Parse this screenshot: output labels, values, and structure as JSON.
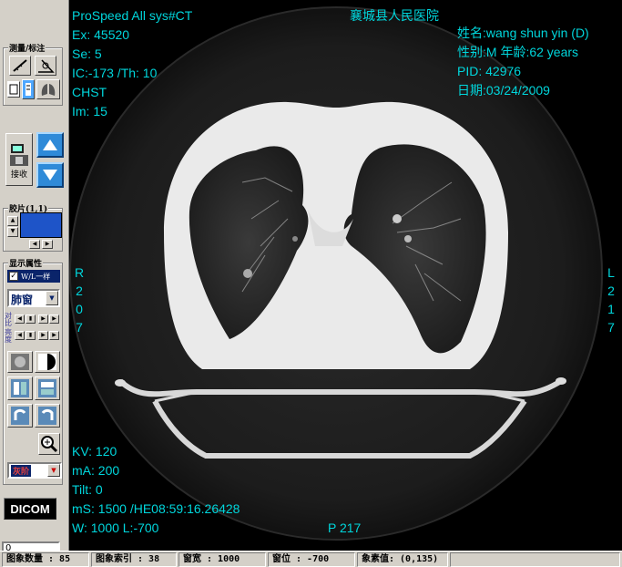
{
  "left_panel": {
    "measure_group_title": "测量/标注",
    "transfer_label": "接收",
    "film_group_title": "胶片(1,1)",
    "display_group_title": "显示属性",
    "same_checkbox_label": "W/L一样",
    "window_preset": "肺窗",
    "contrast_label": "对比",
    "brightness_label": "亮度",
    "color_select": "灰阶",
    "dicom_label": "DICOM",
    "input_value": "0"
  },
  "overlay": {
    "top_left": [
      "ProSpeed All  sys#CT",
      "Ex: 45520",
      "Se: 5",
      "IC:-173 /Th: 10",
      "CHST",
      "Im: 15"
    ],
    "hospital": "襄城县人民医院",
    "top_right": [
      "姓名:wang shun yin (D)",
      "性别:M  年龄:62 years",
      "PID: 42976",
      "日期:03/24/2009"
    ],
    "right_orient": [
      "L",
      "2",
      "1",
      "7"
    ],
    "left_orient": [
      "R",
      "2",
      "0",
      "7"
    ],
    "bottom_left": [
      "KV: 120",
      "mA: 200",
      "Tilt: 0",
      "mS: 1500  /HE08:59:16.26428",
      "W: 1000 L:-700"
    ],
    "bottom_center": "P 217"
  },
  "status": {
    "image_count": "图象数量 : 85",
    "image_index": "图象索引 : 38",
    "window_width": "窗宽 : 1000",
    "window_level": "窗位 : -700",
    "pixel_value": "象素值: (0,135)"
  },
  "colors": {
    "overlay_text": "#00d6dc",
    "nav_button": "#2f8ad8",
    "film_cell": "#1e54c8"
  }
}
